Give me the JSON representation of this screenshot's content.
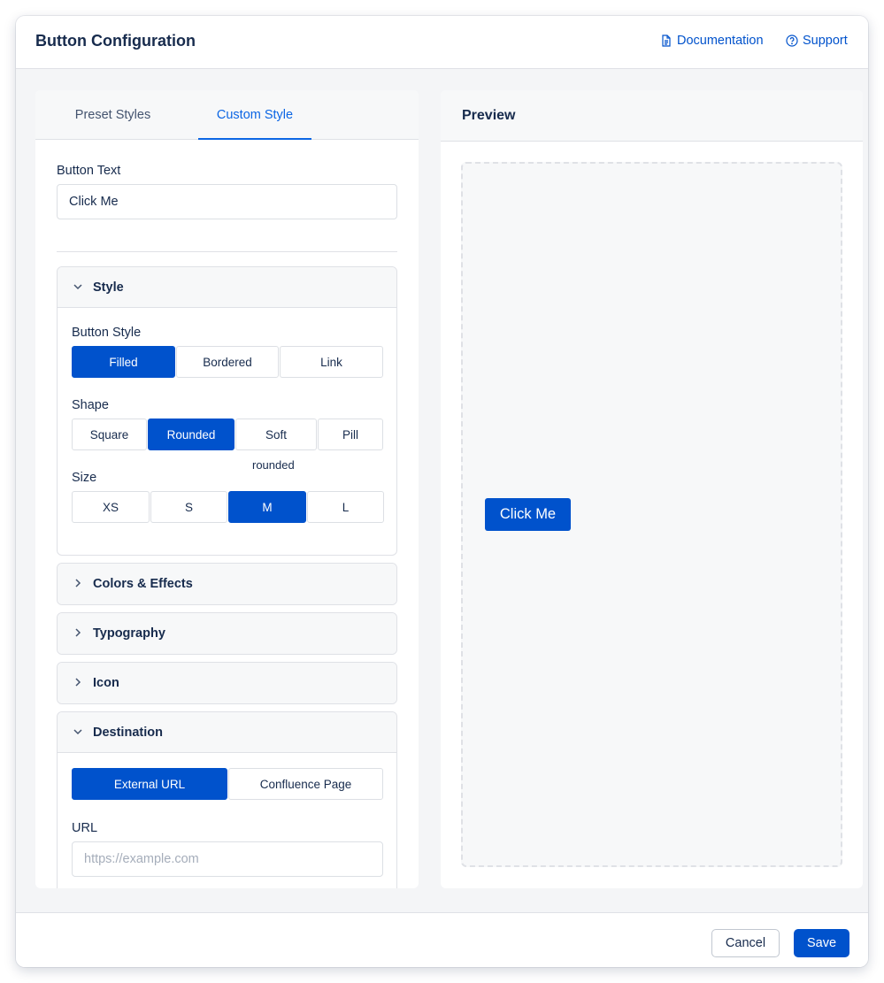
{
  "header": {
    "title": "Button Configuration",
    "documentation_label": "Documentation",
    "support_label": "Support",
    "documentation_icon": "document-icon",
    "support_icon": "help-circle-icon"
  },
  "tabs": [
    {
      "label": "Preset Styles",
      "active": false
    },
    {
      "label": "Custom Style",
      "active": true
    }
  ],
  "form": {
    "button_text_label": "Button Text",
    "button_text_value": "Click Me",
    "style_section": {
      "title": "Style",
      "expanded": true,
      "button_style_label": "Button Style",
      "button_style_options": [
        "Filled",
        "Bordered",
        "Link"
      ],
      "button_style_selected": "Filled",
      "shape_label": "Shape",
      "shape_options": [
        "Square",
        "Rounded",
        "Soft",
        "Pill"
      ],
      "shape_selected": "Rounded",
      "shape_hint": "rounded",
      "size_label": "Size",
      "size_options": [
        "XS",
        "S",
        "M",
        "L"
      ],
      "size_selected": "M"
    },
    "colors_section": {
      "title": "Colors & Effects",
      "expanded": false
    },
    "typography_section": {
      "title": "Typography",
      "expanded": false
    },
    "icon_section": {
      "title": "Icon",
      "expanded": false
    },
    "destination_section": {
      "title": "Destination",
      "expanded": true,
      "options": [
        "External URL",
        "Confluence Page"
      ],
      "selected": "External URL",
      "url_label": "URL",
      "url_placeholder": "https://example.com",
      "url_value": ""
    }
  },
  "preview": {
    "title": "Preview",
    "button_label": "Click Me"
  },
  "footer": {
    "cancel_label": "Cancel",
    "save_label": "Save"
  },
  "colors": {
    "primary": "#0052cc",
    "tab_active": "#0c66e4",
    "text": "#172b4d",
    "border": "#dfe1e6"
  }
}
